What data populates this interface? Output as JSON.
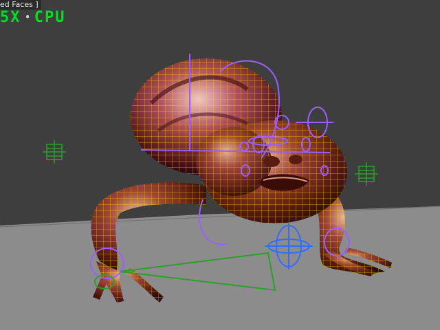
{
  "viewport": {
    "label": "ed Faces ]",
    "background": "#3e3e3e",
    "ground_color": "#8c8c8c"
  },
  "hud": {
    "fps_text": "5X",
    "separator": "•",
    "mode_text": "CPU",
    "color": "#00e020"
  },
  "scene": {
    "object": "creature-model",
    "wireframe_color": "#ffd400",
    "skin_color": "#7a2f1f",
    "rig_color_primary": "#9a60ff",
    "rig_color_secondary": "#2f6cff",
    "helper_color": "#2aa02a"
  }
}
